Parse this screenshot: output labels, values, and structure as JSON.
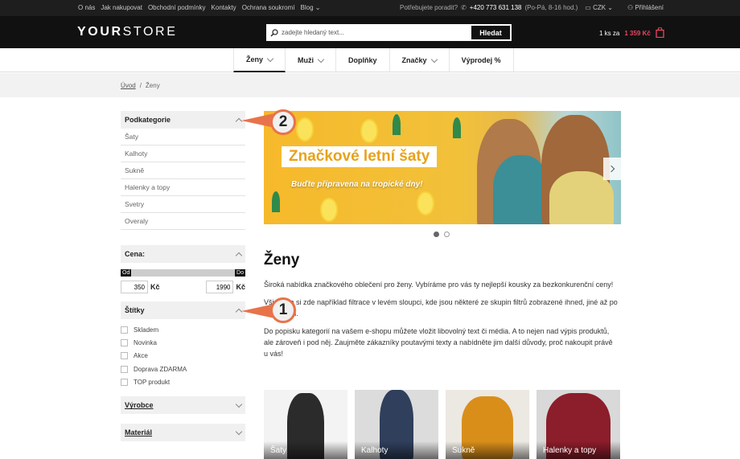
{
  "topbar": {
    "links": [
      "O nás",
      "Jak nakupovat",
      "Obchodní podmínky",
      "Kontakty",
      "Ochrana soukromí",
      "Blog"
    ],
    "help_text": "Potřebujete poradit?",
    "phone": "+420 773 631 138",
    "hours": "(Po-Pá, 8-16 hod.)",
    "currency": "CZK",
    "login": "Přihlášení"
  },
  "header": {
    "logo_your": "YOUR",
    "logo_store": "STORE",
    "search_placeholder": "zadejte hledaný text...",
    "search_button": "Hledat",
    "cart_count": "1 ks za",
    "cart_price": "1 359 Kč"
  },
  "nav": [
    "Ženy",
    "Muži",
    "Doplňky",
    "Značky",
    "Výprodej %"
  ],
  "breadcrumb": {
    "home": "Úvod",
    "separator": "/",
    "current": "Ženy"
  },
  "sidebar": {
    "subcategories_title": "Podkategorie",
    "subcategories": [
      "Šaty",
      "Kalhoty",
      "Sukně",
      "Halenky a topy",
      "Svetry",
      "Overaly"
    ],
    "price_title": "Cena:",
    "price_from_label": "Od",
    "price_to_label": "Do",
    "price_from": "350",
    "price_to": "1990",
    "currency": "Kč",
    "tags_title": "Štítky",
    "tags": [
      "Skladem",
      "Novinka",
      "Akce",
      "Doprava ZDARMA",
      "TOP produkt"
    ],
    "manufacturer_title": "Výrobce",
    "material_title": "Materiál"
  },
  "banner": {
    "title": "Značkové letní šaty",
    "subtitle": "Buďte připravena na tropické dny!",
    "slides": 2,
    "active_slide": 1
  },
  "content": {
    "heading": "Ženy",
    "p1": "Široká nabídka značkového oblečení pro ženy. Vybíráme pro vás ty nejlepší kousky za bezkonkurenční ceny!",
    "p2": "Všimněte si zde například filtrace v levém sloupci, kde jsou některé ze skupin filtrů zobrazené ihned, jiné až po rozkliknutí.",
    "p3": "Do popisku kategorií na vašem e-shopu můžete vložit libovolný text či média. A to nejen nad výpis produktů, ale zároveň i pod něj. Zaujměte zákazníky poutavými texty a nabídněte jim další důvody, proč nakoupit právě u vás!"
  },
  "categories": [
    "Šaty",
    "Kalhoty",
    "Sukně",
    "Halenky a topy"
  ],
  "callouts": [
    "1",
    "2"
  ],
  "colors": {
    "accent": "#e94560",
    "callout_border": "#e8734a",
    "banner_title": "#e8a21a"
  }
}
